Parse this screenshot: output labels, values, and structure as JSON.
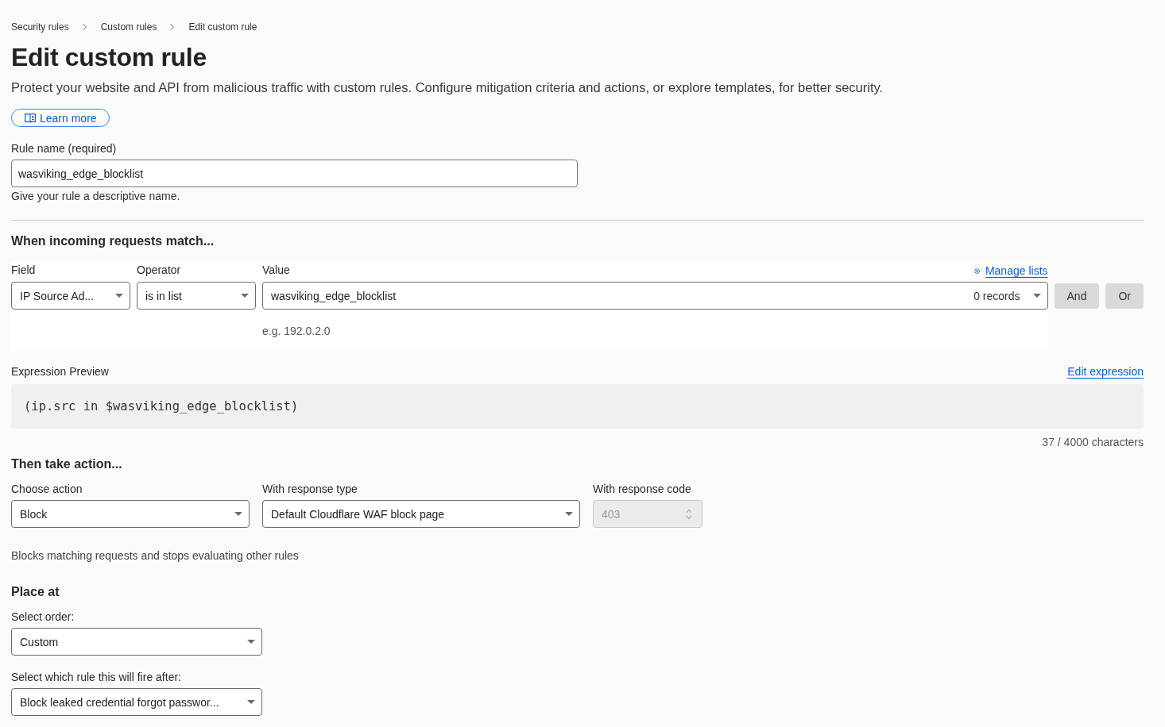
{
  "breadcrumbs": [
    {
      "label": "Security rules"
    },
    {
      "label": "Custom rules"
    },
    {
      "label": "Edit custom rule"
    }
  ],
  "page": {
    "title": "Edit custom rule",
    "description": "Protect your website and API from malicious traffic with custom rules. Configure mitigation criteria and actions, or explore templates, for better security.",
    "learn_more": "Learn more"
  },
  "rule_name": {
    "label": "Rule name (required)",
    "value": "wasviking_edge_blocklist",
    "help": "Give your rule a descriptive name."
  },
  "match": {
    "heading": "When incoming requests match...",
    "columns": [
      "Field",
      "Operator",
      "Value"
    ],
    "manage_lists": "Manage lists",
    "condition": {
      "field": "IP Source Ad...",
      "operator": "is in list",
      "value": "wasviking_edge_blocklist",
      "records": "0 records",
      "hint": "e.g. 192.0.2.0"
    },
    "buttons": [
      {
        "label": "And"
      },
      {
        "label": "Or"
      }
    ]
  },
  "expression": {
    "label": "Expression Preview",
    "edit_link": "Edit expression",
    "code": "(ip.src in $wasviking_edge_blocklist)",
    "count": "37 / 4000 characters"
  },
  "action": {
    "heading": "Then take action...",
    "fields": [
      {
        "kind": "select",
        "label": "Choose action",
        "value": "Block",
        "disabled": false
      },
      {
        "kind": "select",
        "label": "With response type",
        "value": "Default Cloudflare WAF block page",
        "disabled": false
      },
      {
        "kind": "number",
        "label": "With response code",
        "value": "403",
        "disabled": true
      }
    ],
    "note": "Blocks matching requests and stops evaluating other rules"
  },
  "placement": {
    "heading": "Place at",
    "fields": [
      {
        "label": "Select order:",
        "value": "Custom"
      },
      {
        "label": "Select which rule this will fire after:",
        "value": "Block leaked credential forgot passwor..."
      }
    ]
  }
}
